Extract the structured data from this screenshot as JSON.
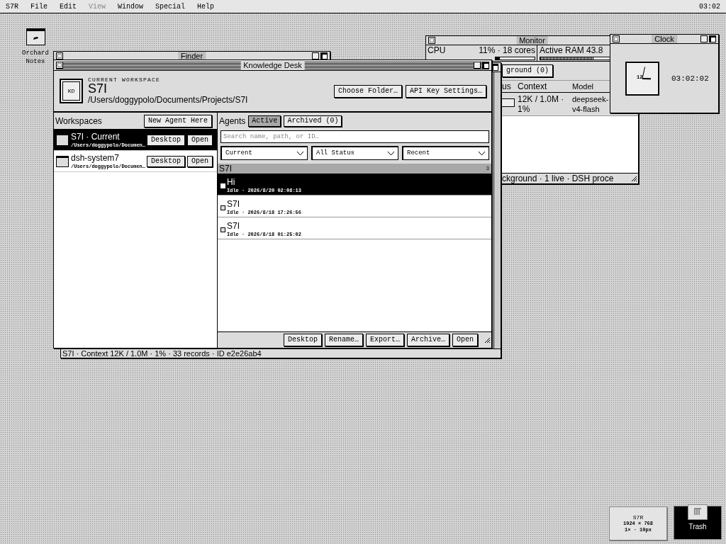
{
  "menu_bar": {
    "items": [
      {
        "label": "S7R",
        "disabled": false
      },
      {
        "label": "File",
        "disabled": false
      },
      {
        "label": "Edit",
        "disabled": false
      },
      {
        "label": "View",
        "disabled": true
      },
      {
        "label": "Window",
        "disabled": false
      },
      {
        "label": "Special",
        "disabled": false
      },
      {
        "label": "Help",
        "disabled": false
      }
    ],
    "time": "03:02"
  },
  "desktop_icons": [
    {
      "label": "Orchard Notes"
    }
  ],
  "finder_window": {
    "title": "Finder"
  },
  "back_window": {
    "status": "S7I · Context 12K / 1.0M · 1% · 33 records · ID e2e26ab4"
  },
  "monitor_window": {
    "title": "Monitor",
    "cpu": {
      "label": "CPU",
      "reading": "11% · 18 cores",
      "level": 0.11
    },
    "ram": {
      "label": "Active RAM 43.8",
      "level": 0.5
    },
    "tab": "ground (0)",
    "columns": [
      "us",
      "Context",
      "Model"
    ],
    "rows": [
      {
        "context": "12K / 1.0M · 1%",
        "model": "deepseek-v4-flash"
      }
    ],
    "status": "ckground · 1 live · DSH proce"
  },
  "clock_window": {
    "title": "Clock",
    "numeral": "12",
    "time": "03:02:02"
  },
  "knowledge_desk": {
    "title": "Knowledge Desk",
    "logo": "KD",
    "caption": "CURRENT WORKSPACE",
    "workspace": "S7I",
    "path": "/Users/doggypolo/Documents/Projects/S7I",
    "header_buttons": [
      "Choose Folder…",
      "API Key Settings…"
    ],
    "workspaces": {
      "title": "Workspaces",
      "button": "New Agent Here",
      "items": [
        {
          "name": "S7I · Current",
          "path": "/Users/doggypolo/Documen…",
          "selected": true,
          "buttons": [
            "Desktop",
            "Open"
          ]
        },
        {
          "name": "dsh-system7",
          "path": "/Users/doggypolo/Documen…",
          "selected": false,
          "buttons": [
            "Desktop",
            "Open"
          ]
        }
      ]
    },
    "agents": {
      "title": "Agents",
      "tabs": [
        {
          "label": "Active",
          "selected": true
        },
        {
          "label": "Archived (0)",
          "selected": false
        }
      ],
      "search": {
        "placeholder": "Search name, path, or ID…"
      },
      "filters": [
        "Current",
        "All Status",
        "Recent"
      ],
      "group": {
        "name": "S7I",
        "count": "3"
      },
      "rows": [
        {
          "title": "Hi",
          "meta": "Idle · 2026/8/20 02:08:13",
          "selected": true
        },
        {
          "title": "S7I",
          "meta": "Idle · 2026/8/18 17:26:56",
          "selected": false
        },
        {
          "title": "S7I",
          "meta": "Idle · 2026/8/18 01:25:02",
          "selected": false
        }
      ],
      "footer_buttons": [
        "Desktop",
        "Rename…",
        "Export…",
        "Archive…",
        "Open"
      ]
    }
  },
  "system_info": {
    "lines": [
      "S7R",
      "1024 × 768",
      "1× · 10px"
    ]
  },
  "trash": {
    "label": "Trash"
  }
}
